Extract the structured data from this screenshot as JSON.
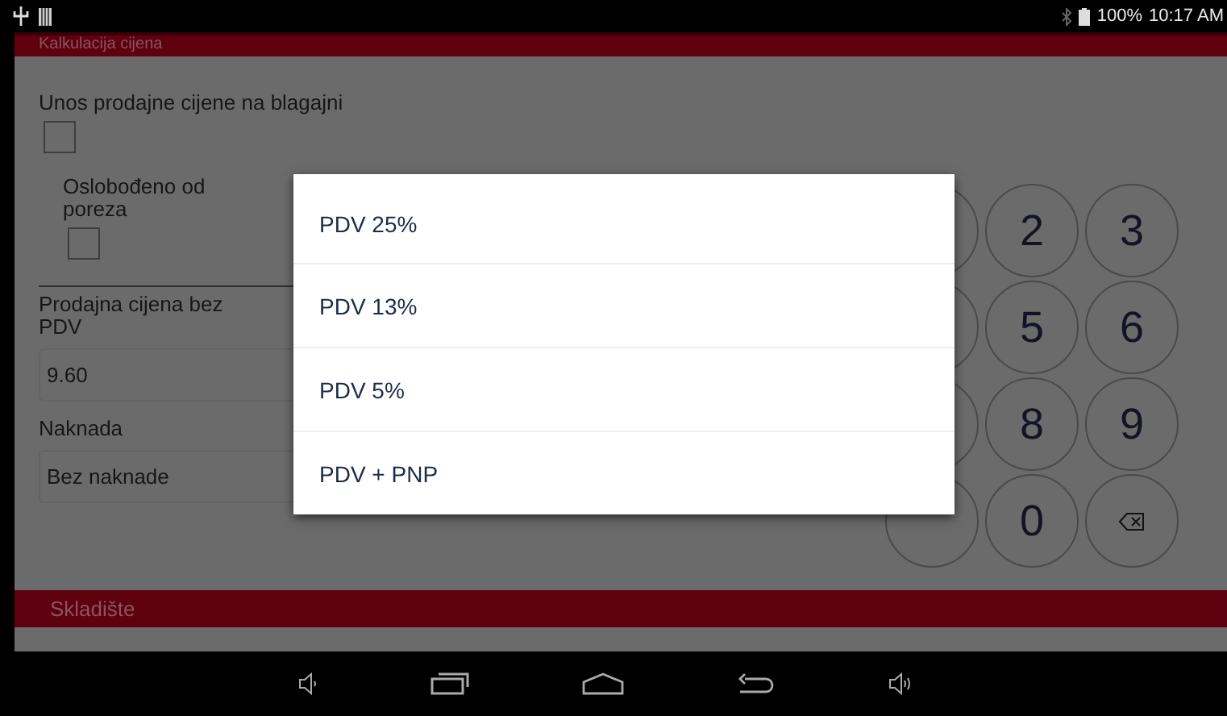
{
  "status_bar": {
    "battery": "100%",
    "time": "10:17 AM"
  },
  "section_title": "Kalkulacija cijena",
  "form": {
    "cash_price_label": "Unos prodajne cijene na blagajni",
    "cash_price_checked": false,
    "tax_exempt_label": "Oslobođeno od poreza",
    "tax_exempt_checked": false,
    "net_price_label": "Prodajna cijena bez PDV",
    "net_price_value": "9.60",
    "fee_label": "Naknada",
    "fee_value": "Bez naknade"
  },
  "keypad": [
    {
      "kind": "hidden"
    },
    {
      "kind": "digit",
      "label": "2"
    },
    {
      "kind": "digit",
      "label": "3"
    },
    {
      "kind": "hidden"
    },
    {
      "kind": "digit",
      "label": "5"
    },
    {
      "kind": "digit",
      "label": "6"
    },
    {
      "kind": "hidden"
    },
    {
      "kind": "digit",
      "label": "8"
    },
    {
      "kind": "digit",
      "label": "9"
    },
    {
      "kind": "hidden"
    },
    {
      "kind": "digit",
      "label": "0"
    },
    {
      "kind": "backspace"
    }
  ],
  "storage_section": "Skladište",
  "dialog": {
    "options": [
      {
        "label": "PDV 25%"
      },
      {
        "label": "PDV 13%"
      },
      {
        "label": "PDV 5%"
      },
      {
        "label": "PDV + PNP"
      }
    ]
  }
}
